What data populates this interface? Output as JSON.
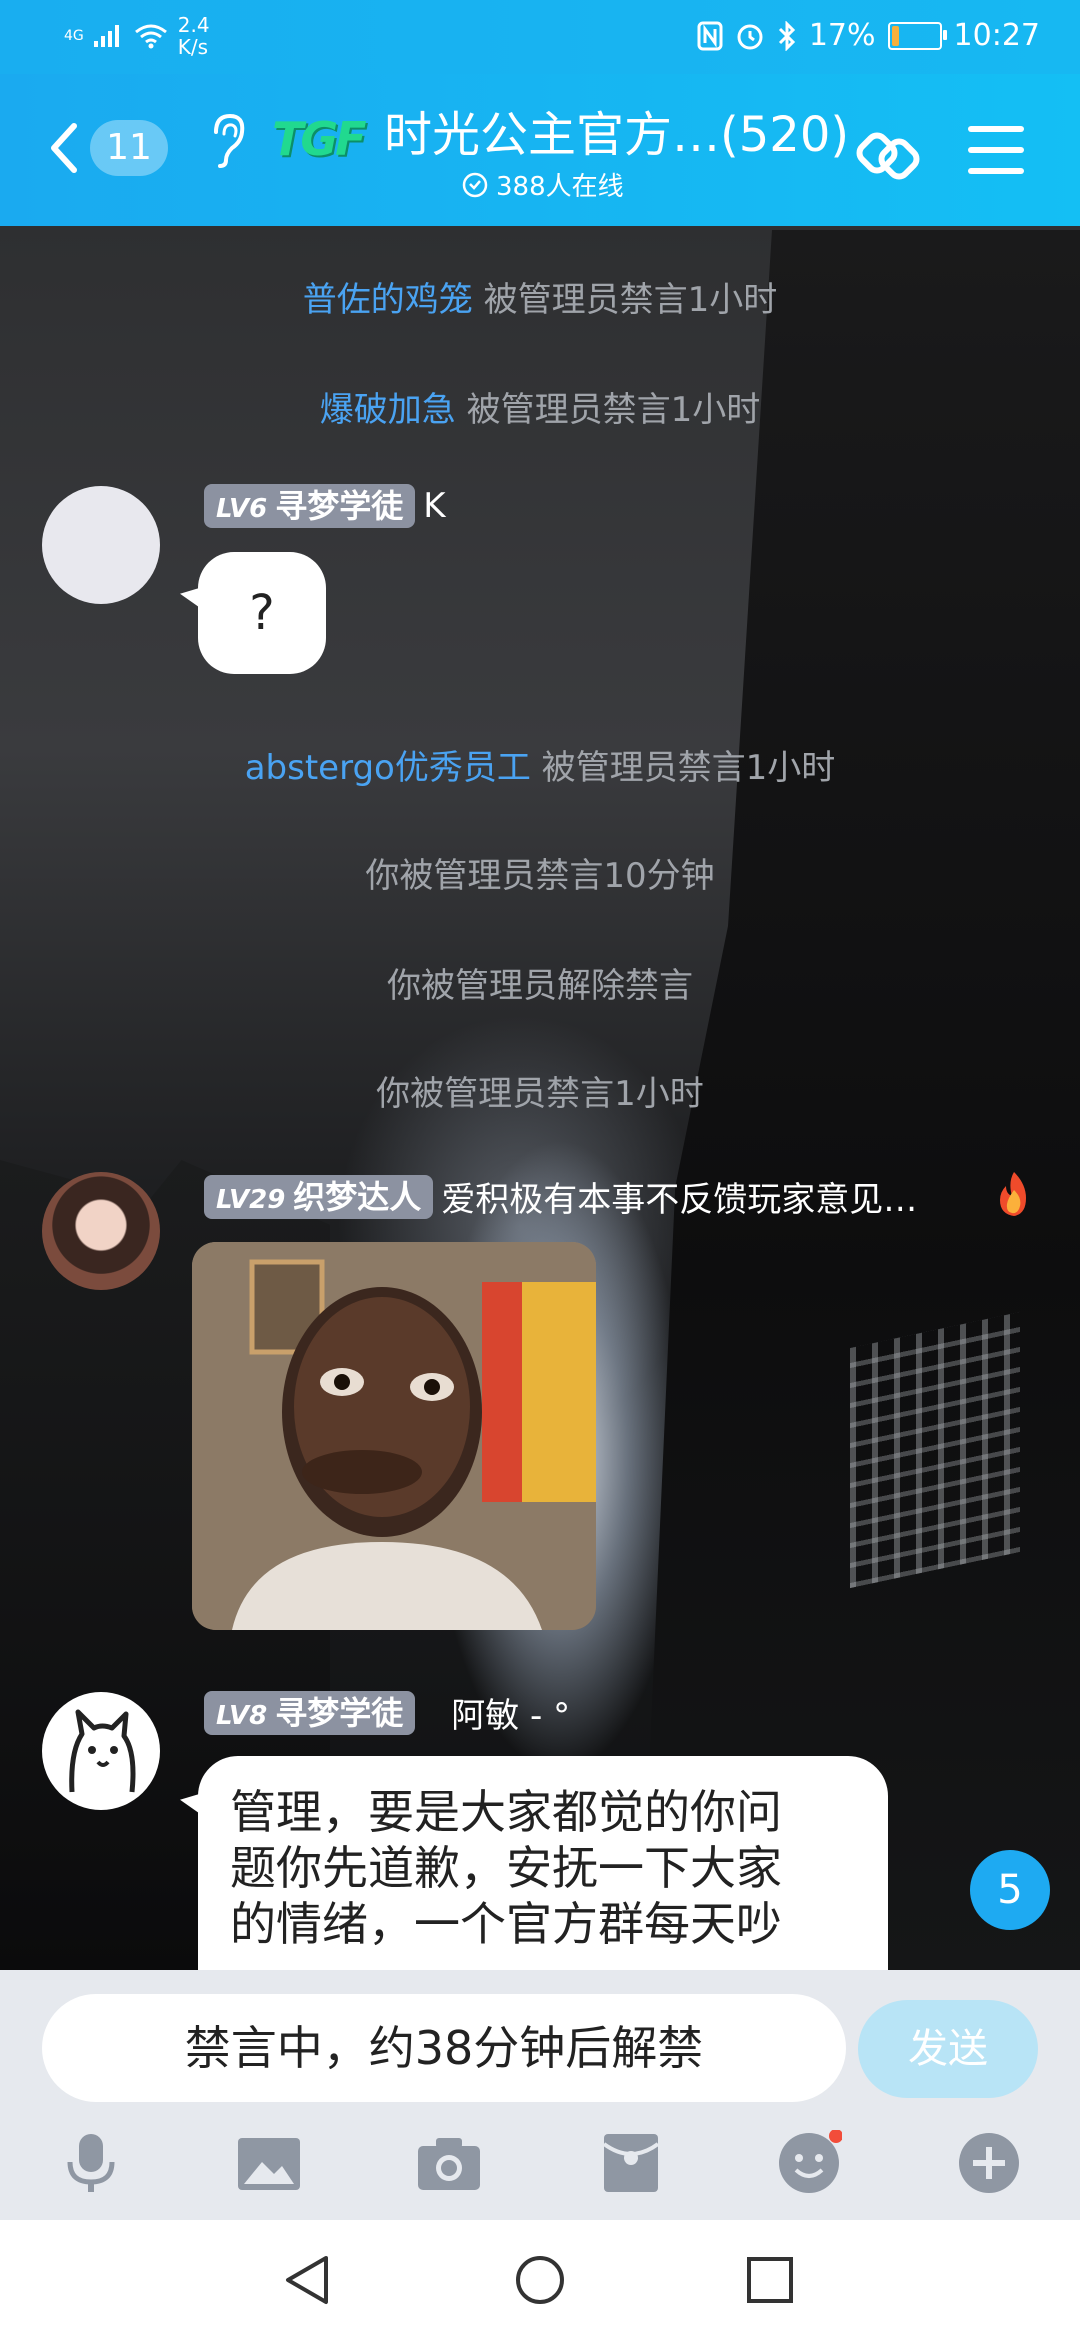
{
  "status_bar": {
    "network": "4G",
    "speed": "2.4",
    "speed_unit": "K/s",
    "battery": "17%",
    "battery_level": 0.17,
    "time": "10:27"
  },
  "header": {
    "unread_count": "11",
    "group_logo": "TGF",
    "title": "时光公主官方…",
    "member_count": "(520)",
    "online": "388人在线"
  },
  "messages": {
    "sys1": {
      "user": "普佐的鸡笼",
      "text": "被管理员禁言1小时"
    },
    "sys2": {
      "user": "爆破加急",
      "text": "被管理员禁言1小时"
    },
    "msg1": {
      "lv": "LV6",
      "title": "寻梦学徒",
      "name": "K",
      "text": "?"
    },
    "sys3": {
      "user": "abstergo优秀员工",
      "text": "被管理员禁言1小时"
    },
    "sys4": {
      "text": "你被管理员禁言10分钟"
    },
    "sys5": {
      "text": "你被管理员解除禁言"
    },
    "sys6": {
      "text": "你被管理员禁言1小时"
    },
    "msg2": {
      "lv": "LV29",
      "title": "织梦达人",
      "name": "爱积极有本事不反馈玩家意见…"
    },
    "msg3": {
      "lv": "LV8",
      "title": "寻梦学徒",
      "name": "阿敏 - °",
      "lines": [
        "管理，要是大家都觉的你问",
        "题你先道歉，安抚一下大家",
        "的情绪，一个官方群每天吵"
      ]
    }
  },
  "scroll_badge": "5",
  "input": {
    "muted_text": "禁言中，约38分钟后解禁",
    "send_label": "发送"
  },
  "colors": {
    "accent": "#17b8f2",
    "username": "#4aa3f2",
    "level_tag": "#8c92a1"
  }
}
